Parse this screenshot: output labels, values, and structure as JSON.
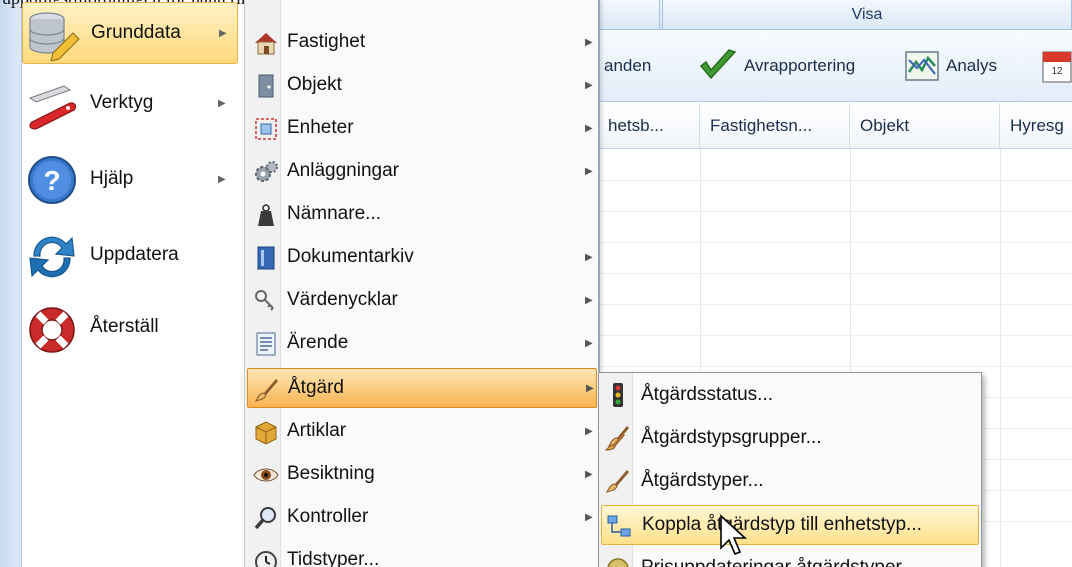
{
  "background": {
    "tab_right": "Visa",
    "ribbon": [
      {
        "label": "anden",
        "icon": "user-icon"
      },
      {
        "label": "Avrapportering",
        "icon": "checkmark-icon"
      },
      {
        "label": "Analys",
        "icon": "chart-icon"
      },
      {
        "label": "",
        "icon": "calendar-icon"
      }
    ],
    "columns": [
      "hetsb...",
      "Fastighetsn...",
      "Objekt",
      "Hyresg"
    ]
  },
  "clipped_top_text": "uppdragstillordningen for hanteringstyper via enhetstyper",
  "left_menu": [
    {
      "label": "Grunddata",
      "icon": "database-icon",
      "has_submenu": true,
      "active": true
    },
    {
      "label": "Verktyg",
      "icon": "swiss-knife-icon",
      "has_submenu": true
    },
    {
      "label": "Hjälp",
      "icon": "help-icon",
      "has_submenu": true
    },
    {
      "label": "Uppdatera",
      "icon": "refresh-icon",
      "has_submenu": false
    },
    {
      "label": "Återställ",
      "icon": "lifebuoy-icon",
      "has_submenu": false
    }
  ],
  "submenu": [
    {
      "label": "Fastighet",
      "icon": "house-icon",
      "arrow": true
    },
    {
      "label": "Objekt",
      "icon": "door-icon",
      "arrow": true
    },
    {
      "label": "Enheter",
      "icon": "units-icon",
      "arrow": true
    },
    {
      "label": "Anläggningar",
      "icon": "gears-icon",
      "arrow": true
    },
    {
      "label": "Nämnare...",
      "icon": "weight-icon",
      "arrow": false
    },
    {
      "label": "Dokumentarkiv",
      "icon": "archive-icon",
      "arrow": true
    },
    {
      "label": "Värdenycklar",
      "icon": "keys-icon",
      "arrow": true
    },
    {
      "label": "Ärende",
      "icon": "document-icon",
      "arrow": true
    },
    {
      "label": "Åtgärd",
      "icon": "brush-icon",
      "arrow": true,
      "active": true
    },
    {
      "label": "Artiklar",
      "icon": "package-icon",
      "arrow": true
    },
    {
      "label": "Besiktning",
      "icon": "eye-icon",
      "arrow": true
    },
    {
      "label": "Kontroller",
      "icon": "magnifier-icon",
      "arrow": true
    },
    {
      "label": "Tidstyper...",
      "icon": "clock-icon",
      "arrow": false
    }
  ],
  "flyout": [
    {
      "label": "Åtgärdsstatus...",
      "icon": "traffic-light-icon"
    },
    {
      "label": "Åtgärdstypsgrupper...",
      "icon": "brushes-icon"
    },
    {
      "label": "Åtgärdstyper...",
      "icon": "brush-icon"
    },
    {
      "label": "Koppla åtgärdstyp till enhetstyp...",
      "icon": "link-icon",
      "active": true
    },
    {
      "label": "Prisuppdateringar åtgärdstyper",
      "icon": "coin-icon"
    }
  ],
  "colors": {
    "highlight": "#f9b451",
    "hover": "#ffe18c",
    "accent": "#2f6db5"
  }
}
